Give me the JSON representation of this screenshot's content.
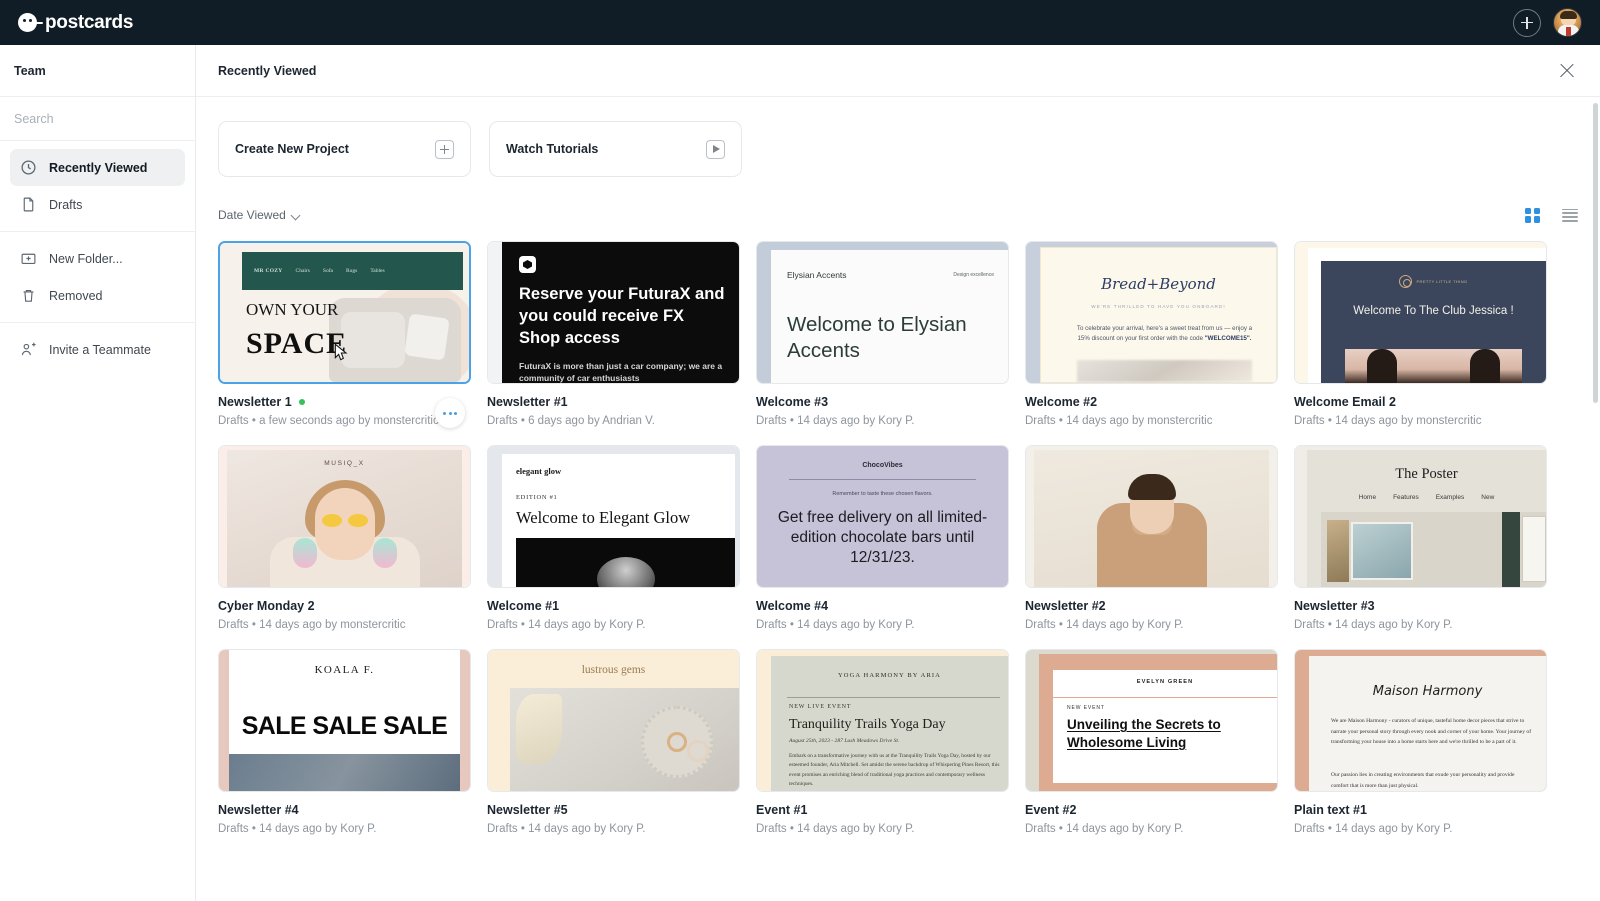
{
  "app": {
    "brand": "postcards",
    "brand_icon": "postcards-logo-icon",
    "add_icon": "plus-circle-icon",
    "avatar_icon": "user-avatar"
  },
  "sidebar": {
    "team_label": "Team",
    "search_placeholder": "Search",
    "search_value": "",
    "groups": [
      {
        "items": [
          {
            "label": "Recently Viewed",
            "icon": "clock-icon",
            "active": true
          },
          {
            "label": "Drafts",
            "icon": "file-icon",
            "active": false
          }
        ]
      },
      {
        "items": [
          {
            "label": "New Folder...",
            "icon": "folder-plus-icon",
            "active": false
          },
          {
            "label": "Removed",
            "icon": "trash-icon",
            "active": false
          }
        ]
      },
      {
        "items": [
          {
            "label": "Invite a Teammate",
            "icon": "user-plus-icon",
            "active": false
          }
        ]
      }
    ]
  },
  "main": {
    "title": "Recently Viewed",
    "close_icon": "close-icon",
    "actions": [
      {
        "label": "Create New Project",
        "icon": "plus-square-icon"
      },
      {
        "label": "Watch Tutorials",
        "icon": "play-square-icon"
      }
    ],
    "sort": {
      "label": "Date Viewed",
      "icon": "chevron-down-icon"
    },
    "view": {
      "grid_icon": "grid-view-icon",
      "list_icon": "list-view-icon",
      "active": "grid"
    },
    "more_icon": "more-options-icon",
    "accent_color": "#2f8fe0",
    "live_dot_color": "#35c05a",
    "cards": [
      {
        "title": "Newsletter 1",
        "live": true,
        "folder": "Drafts",
        "meta": "Drafts  •  a few seconds ago by monstercritic",
        "selected": true,
        "art": {
          "logo": "MR COZY",
          "nav": [
            "Chairs",
            "Sofa",
            "Rugs",
            "Tables"
          ],
          "line1": "OWN YOUR",
          "line2": "SPACE"
        }
      },
      {
        "title": "Newsletter #1",
        "live": false,
        "folder": "Drafts",
        "meta": "Drafts  •  6 days ago by Andrian V.",
        "selected": false,
        "art": {
          "heading": "Reserve your FuturaX and you could receive FX Shop access",
          "body": "FuturaX is more than just a car company; we are a community of car enthusiasts"
        }
      },
      {
        "title": "Welcome #3",
        "live": false,
        "folder": "Drafts",
        "meta": "Drafts  •  14 days ago by Kory P.",
        "selected": false,
        "art": {
          "brand": "Elysian Accents",
          "tagline": "Design excellence",
          "heading": "Welcome to Elysian Accents"
        }
      },
      {
        "title": "Welcome #2",
        "live": false,
        "folder": "Drafts",
        "meta": "Drafts  •  14 days ago by monstercritic",
        "selected": false,
        "art": {
          "logo": "Bread+Beyond",
          "subhead": "WE'RE THRILLED TO HAVE YOU ONBOARD!",
          "body_pre": "To celebrate your arrival, here's a sweet treat from us — enjoy a 15% discount on your first order with the code ",
          "code": "\"WELCOME15\"."
        }
      },
      {
        "title": "Welcome Email 2",
        "live": false,
        "folder": "Drafts",
        "meta": "Drafts  •  14 days ago by monstercritic",
        "selected": false,
        "art": {
          "logo": "PRETTY LITTLE THING",
          "heading": "Welcome To The Club Jessica !"
        }
      },
      {
        "title": "Cyber Monday 2",
        "live": false,
        "folder": "Drafts",
        "meta": "Drafts  •  14 days ago by monstercritic",
        "selected": false,
        "art": {
          "brand": "MUSIQ_X"
        }
      },
      {
        "title": "Welcome #1",
        "live": false,
        "folder": "Drafts",
        "meta": "Drafts  •  14 days ago by Kory P.",
        "selected": false,
        "art": {
          "brand": "elegant glow",
          "edition": "EDITION #1",
          "heading": "Welcome to Elegant Glow"
        }
      },
      {
        "title": "Welcome #4",
        "live": false,
        "folder": "Drafts",
        "meta": "Drafts  •  14 days ago by Kory P.",
        "selected": false,
        "art": {
          "brand": "ChocoVibes",
          "subhead": "Remember to taste these chosen flavors.",
          "heading": "Get free delivery on all limited-edition chocolate bars until 12/31/23."
        }
      },
      {
        "title": "Newsletter #2",
        "live": false,
        "folder": "Drafts",
        "meta": "Drafts  •  14 days ago by Kory P.",
        "selected": false,
        "art": {}
      },
      {
        "title": "Newsletter #3",
        "live": false,
        "folder": "Drafts",
        "meta": "Drafts  •  14 days ago by Kory P.",
        "selected": false,
        "art": {
          "brand": "The Poster",
          "nav": [
            "Home",
            "Features",
            "Examples",
            "New"
          ]
        }
      },
      {
        "title": "Newsletter #4",
        "live": false,
        "folder": "Drafts",
        "meta": "Drafts  •  14 days ago by Kory P.",
        "selected": false,
        "art": {
          "brand": "KOALA F.",
          "heading": "SALE SALE SALE"
        }
      },
      {
        "title": "Newsletter #5",
        "live": false,
        "folder": "Drafts",
        "meta": "Drafts  •  14 days ago by Kory P.",
        "selected": false,
        "art": {
          "brand": "lustrous gems"
        }
      },
      {
        "title": "Event #1",
        "live": false,
        "folder": "Drafts",
        "meta": "Drafts  •  14 days ago by Kory P.",
        "selected": false,
        "art": {
          "brand": "YOGA HARMONY BY ARIA",
          "kicker": "NEW LIVE EVENT",
          "heading": "Tranquility Trails Yoga Day",
          "date": "August 25th, 2023 - 287 Lush Meadows Drive St.",
          "body": "Embark on a transformative journey with us at the Tranquility Trails Yoga Day, hosted by our esteemed founder, Aria Mitchell. Set amidst the serene backdrop of Whispering Pines Resort, this event promises an enriching blend of traditional yoga practices and contemporary wellness techniques."
        }
      },
      {
        "title": "Event #2",
        "live": false,
        "folder": "Drafts",
        "meta": "Drafts  •  14 days ago by Kory P.",
        "selected": false,
        "art": {
          "brand": "EVELYN GREEN",
          "kicker": "NEW EVENT",
          "heading": "Unveiling the Secrets to Wholesome Living"
        }
      },
      {
        "title": "Plain text #1",
        "live": false,
        "folder": "Drafts",
        "meta": "Drafts  •  14 days ago by Kory P.",
        "selected": false,
        "art": {
          "brand": "Maison Harmony",
          "body1": "We are Maison Harmony - curators of unique, tasteful home decor pieces that strive to narrate your personal story through every nook and corner of your home. Your journey of transforming your house into a home starts here and we're thrilled to be a part of it.",
          "body2": "Our passion lies in creating environments that exude your personality and provide comfort that is more than just physical."
        }
      }
    ]
  }
}
